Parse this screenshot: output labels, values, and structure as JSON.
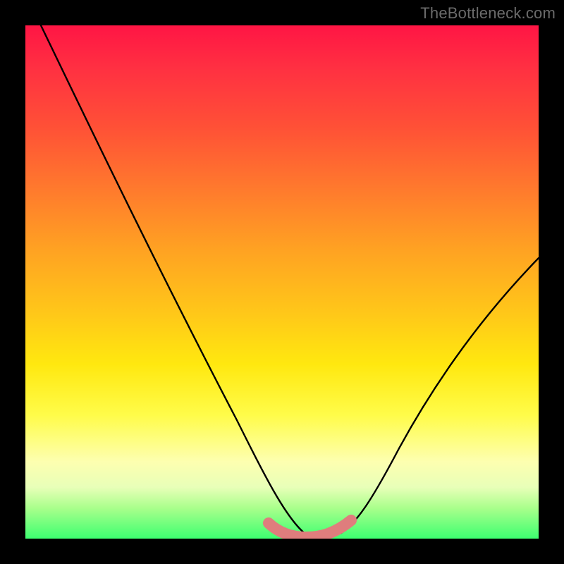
{
  "watermark": "TheBottleneck.com",
  "chart_data": {
    "type": "line",
    "title": "",
    "xlabel": "",
    "ylabel": "",
    "xlim": [
      0,
      100
    ],
    "ylim": [
      0,
      100
    ],
    "grid": false,
    "legend": false,
    "series": [
      {
        "name": "black-curve",
        "color": "#000000",
        "x": [
          3,
          10,
          20,
          30,
          40,
          47,
          52,
          56,
          60,
          63,
          70,
          80,
          90,
          100
        ],
        "values": [
          100,
          88,
          70,
          52,
          34,
          20,
          8,
          2,
          0,
          2,
          12,
          28,
          42,
          55
        ]
      },
      {
        "name": "pink-band",
        "color": "#e07a7a",
        "x": [
          47,
          50,
          53,
          56,
          58,
          60,
          62,
          64
        ],
        "values": [
          3,
          1.5,
          0.8,
          0.5,
          0.5,
          0.8,
          1.8,
          3.5
        ]
      }
    ],
    "gradient_stops": [
      {
        "pos": 0,
        "color": "#ff1544"
      },
      {
        "pos": 50,
        "color": "#ffc719"
      },
      {
        "pos": 85,
        "color": "#fdffb0"
      },
      {
        "pos": 100,
        "color": "#3dff70"
      }
    ]
  }
}
